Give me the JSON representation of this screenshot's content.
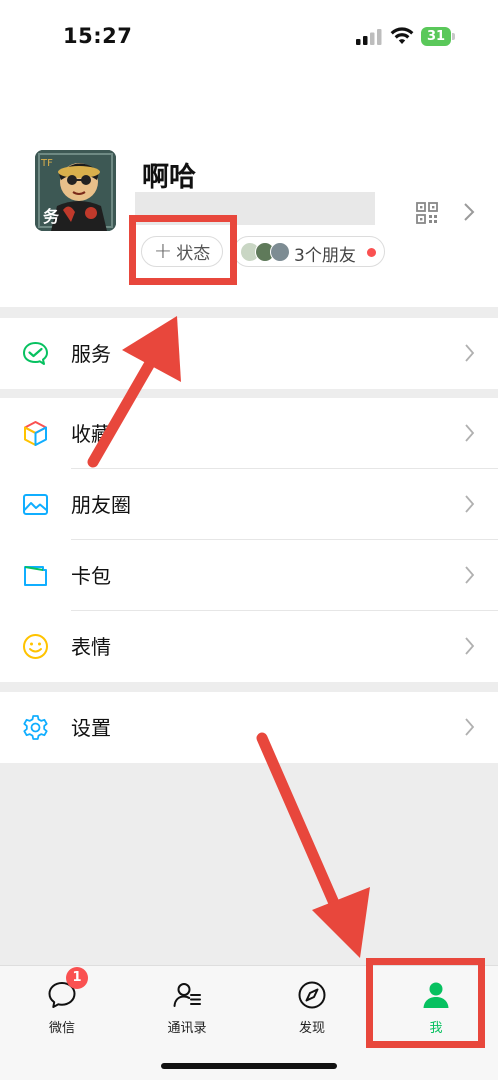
{
  "status_bar": {
    "time": "15:27",
    "battery": "31"
  },
  "profile": {
    "nickname": "啊哈",
    "status_button": "状态",
    "friends_status": "3个朋友"
  },
  "menu": {
    "service": "服务",
    "favorites": "收藏",
    "moments": "朋友圈",
    "cards": "卡包",
    "stickers": "表情",
    "settings": "设置"
  },
  "tabbar": {
    "tabs": [
      {
        "label": "微信",
        "badge": "1"
      },
      {
        "label": "通讯录"
      },
      {
        "label": "发现"
      },
      {
        "label": "我"
      }
    ]
  },
  "colors": {
    "accent": "#07c160",
    "badge": "#fa5151",
    "annotation": "#e8473c"
  }
}
